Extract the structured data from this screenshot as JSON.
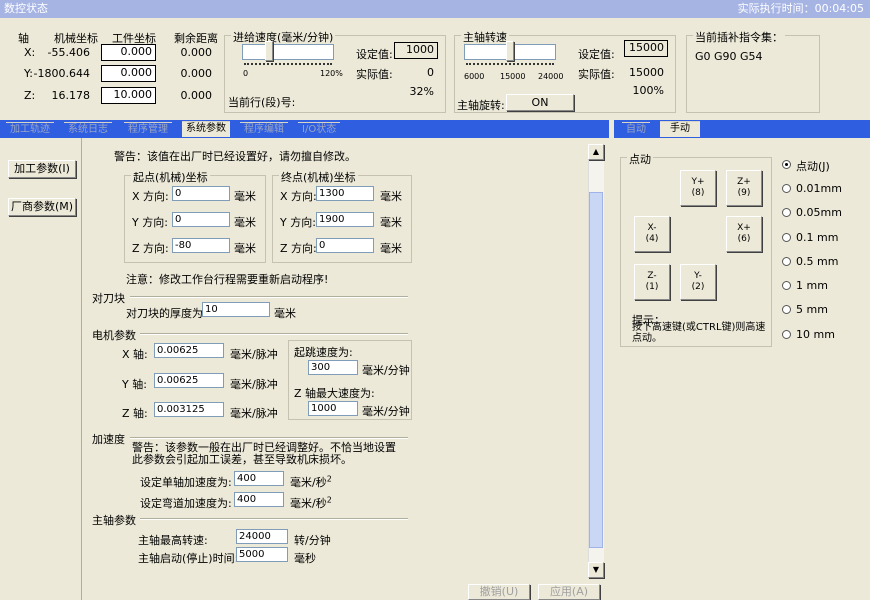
{
  "title": "数控状态",
  "runtime": "实际执行时间：00:04:05",
  "axes": {
    "h_axis": "轴",
    "h_machine": "机械坐标",
    "h_work": "工件坐标",
    "h_remain": "剩余距离",
    "rows": [
      {
        "name": "X:",
        "machine": "-55.406",
        "work": "0.000",
        "remain": "0.000"
      },
      {
        "name": "Y:",
        "machine": "-1800.644",
        "work": "0.000",
        "remain": "0.000"
      },
      {
        "name": "Z:",
        "machine": "16.178",
        "work": "10.000",
        "remain": "0.000"
      }
    ]
  },
  "feed": {
    "title": "进给速度(毫米/分钟)",
    "set_label": "设定值:",
    "set_value": "1000",
    "actual_label": "实际值:",
    "actual_value": "0",
    "percent": "32%",
    "min": "0",
    "max": "120%",
    "line_label": "当前行(段)号:",
    "slider_level": 0.27
  },
  "spindle": {
    "title": "主轴转速",
    "set_label": "设定值:",
    "set_value": "15000",
    "actual_label": "实际值:",
    "actual_value": "15000",
    "percent": "100%",
    "t1": "6000",
    "t2": "15000",
    "t3": "24000",
    "rotate_label": "主轴旋转:",
    "on_label": "ON",
    "slider_level": 0.5
  },
  "interp": {
    "title": "当前插补指令集：",
    "value": "G0 G90 G54"
  },
  "left_tabs": [
    "加工轨迹",
    "系统日志",
    "程序管理",
    "系统参数",
    "程序编辑",
    "I/O状态"
  ],
  "side_buttons": [
    "加工参数(I)",
    "厂商参数(M)"
  ],
  "warning1": "警告：该值在出厂时已经设置好，请勿擅自修改。",
  "start": {
    "title": "起点(机械)坐标",
    "x_label": "X 方向:",
    "x": "0",
    "y_label": "Y 方向:",
    "y": "0",
    "z_label": "Z 方向:",
    "z": "-80",
    "unit": "毫米"
  },
  "end": {
    "title": "终点(机械)坐标",
    "x_label": "X 方向:",
    "x": "1300",
    "y_label": "Y 方向:",
    "y": "1900",
    "z_label": "Z 方向:",
    "z": "0",
    "unit": "毫米"
  },
  "note": "注意：修改工作台行程需要重新启动程序!",
  "tool_block": {
    "title": "对刀块",
    "label": "对刀块的厚度为",
    "value": "10",
    "unit": "毫米"
  },
  "motor": {
    "title": "电机参数",
    "x_label": "X 轴:",
    "x": "0.00625",
    "y_label": "Y 轴:",
    "y": "0.00625",
    "z_label": "Z 轴:",
    "z": "0.003125",
    "unit": "毫米/脉冲",
    "jump_label": "起跳速度为:",
    "jump": "300",
    "jump_unit": "毫米/分钟",
    "zmax_label": "Z 轴最大速度为:",
    "zmax": "1000",
    "zmax_unit": "毫米/分钟"
  },
  "accel": {
    "title": "加速度",
    "warning": "警告：该参数一般在出厂时已经调整好。不恰当地设置此参数会引起加工误差，甚至导致机床损坏。",
    "single_label": "设定单轴加速度为:",
    "single": "400",
    "curve_label": "设定弯道加速度为:",
    "curve": "400",
    "unit": "毫米/秒",
    "sup": "2"
  },
  "spindle_param": {
    "title": "主轴参数",
    "max_label": "主轴最高转速:",
    "max": "24000",
    "max_unit": "转/分钟",
    "delay_label": "主轴启动(停止)时间:",
    "delay": "5000",
    "delay_unit": "毫秒"
  },
  "bottom_buttons": {
    "cancel": "撤销(U)",
    "apply": "应用(A)"
  },
  "right_tabs": [
    "自动",
    "手动"
  ],
  "jog": {
    "title": "点动",
    "yplus": "Y+",
    "yplus_k": "(8)",
    "zplus": "Z+",
    "zplus_k": "(9)",
    "xminus": "X-",
    "xminus_k": "(4)",
    "xplus": "X+",
    "xplus_k": "(6)",
    "zminus": "Z-",
    "zminus_k": "(1)",
    "yminus": "Y-",
    "yminus_k": "(2)",
    "tip_title": "提示：",
    "tip": "按下高速键(或CTRL键)则高速点动。"
  },
  "steps": [
    "点动(J)",
    "0.01mm",
    "0.05mm",
    "0.1 mm",
    "0.5 mm",
    "1 mm",
    "5 mm",
    "10 mm"
  ]
}
